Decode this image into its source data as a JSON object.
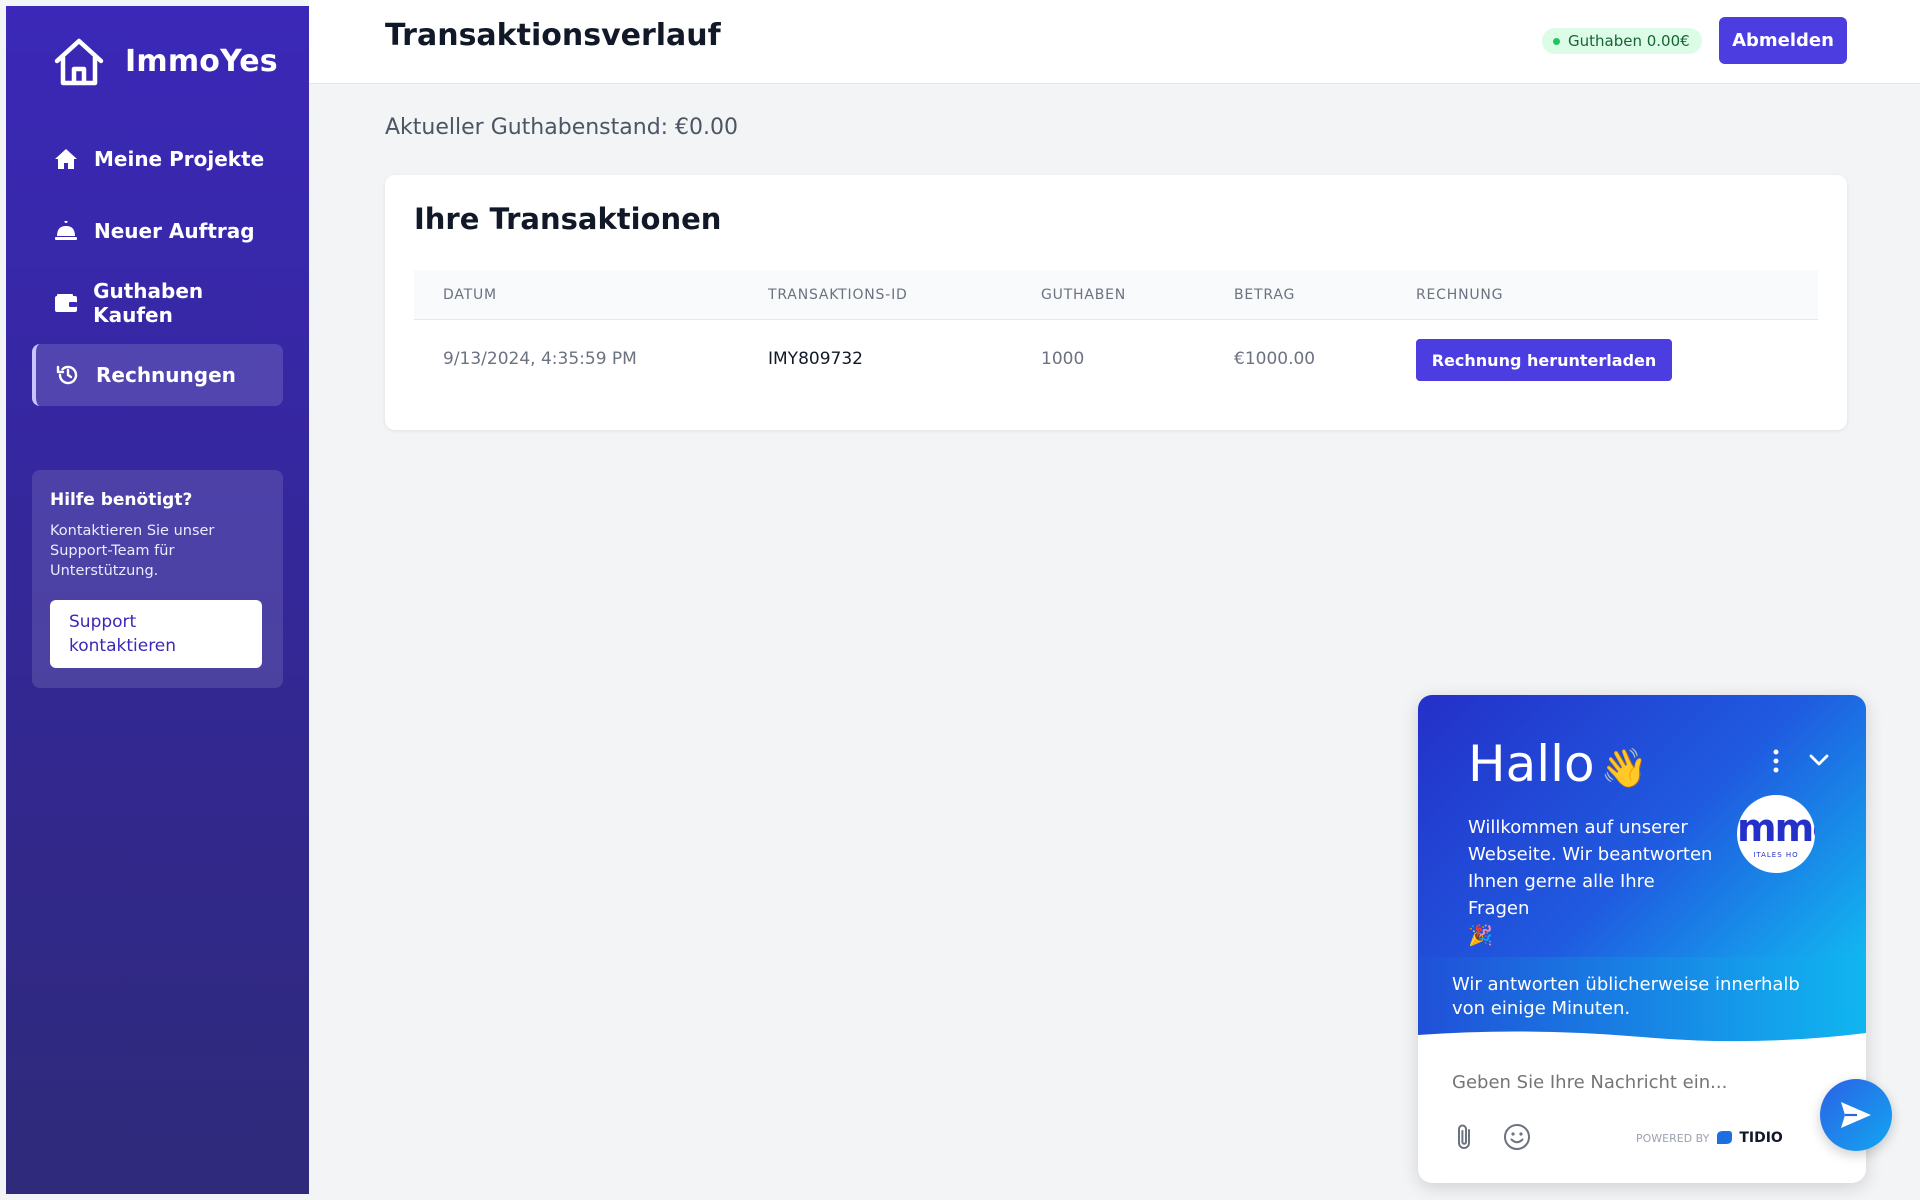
{
  "brand": {
    "name": "ImmoYes"
  },
  "nav": [
    {
      "label": "Meine Projekte",
      "icon": "home-icon"
    },
    {
      "label": "Neuer Auftrag",
      "icon": "bell-icon"
    },
    {
      "label": "Guthaben Kaufen",
      "icon": "wallet-icon"
    },
    {
      "label": "Rechnungen",
      "icon": "history-icon",
      "active": true
    }
  ],
  "help": {
    "title": "Hilfe benötigt?",
    "text": "Kontaktieren Sie unser Support-Team für Unterstützung.",
    "button": "Support kontaktieren"
  },
  "header": {
    "title": "Transaktionsverlauf",
    "balance_badge": "Guthaben 0.00€",
    "logout": "Abmelden"
  },
  "current_balance": "Aktueller Guthabenstand: €0.00",
  "transactions": {
    "title": "Ihre Transaktionen",
    "columns": [
      "DATUM",
      "TRANSAKTIONS-ID",
      "GUTHABEN",
      "BETRAG",
      "RECHNUNG"
    ],
    "rows": [
      {
        "date": "9/13/2024, 4:35:59 PM",
        "id": "IMY809732",
        "credits": "1000",
        "amount": "€1000.00",
        "action": "Rechnung herunterladen"
      }
    ]
  },
  "chat": {
    "greeting": "Hallo",
    "wave": "👋",
    "welcome": "Willkommen auf unserer Webseite. Wir beantworten Ihnen gerne alle Ihre Fragen",
    "party": "🎉",
    "avatar_text": "mmo",
    "avatar_subtext": "ITALES HO",
    "response_time": "Wir antworten üblicherweise innerhalb von einige Minuten.",
    "placeholder": "Geben Sie Ihre Nachricht ein...",
    "powered_by": "POWERED BY",
    "powered_brand": "TIDIO"
  },
  "colors": {
    "sidebar": "#3b28b8",
    "accent": "#4c3de0",
    "badge_bg": "#dcfce7",
    "chat_gradient_start": "#2430c9",
    "chat_gradient_end": "#12b7f0"
  }
}
